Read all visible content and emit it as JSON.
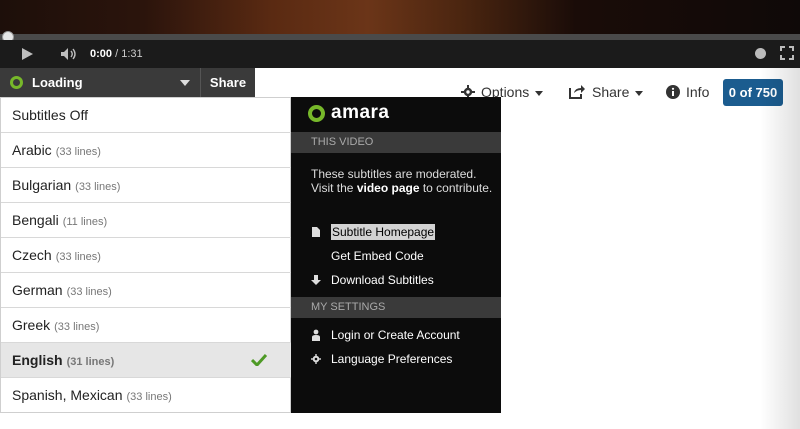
{
  "player": {
    "time_current": "0:00",
    "time_separator": " / ",
    "time_total": "1:31",
    "progress": 0.0
  },
  "subtitle_bar": {
    "status": "Loading",
    "share_label": "Share"
  },
  "toolbar": {
    "options_label": "Options",
    "share_label": "Share",
    "info_label": "Info",
    "counter": "0 of 750"
  },
  "languages": [
    {
      "name": "Subtitles Off",
      "count": "",
      "selected": false
    },
    {
      "name": "Arabic",
      "count": "(33 lines)",
      "selected": false
    },
    {
      "name": "Bulgarian",
      "count": "(33 lines)",
      "selected": false
    },
    {
      "name": "Bengali",
      "count": "(11 lines)",
      "selected": false
    },
    {
      "name": "Czech",
      "count": "(33 lines)",
      "selected": false
    },
    {
      "name": "German",
      "count": "(33 lines)",
      "selected": false
    },
    {
      "name": "Greek",
      "count": "(33 lines)",
      "selected": false
    },
    {
      "name": "English",
      "count": "(31 lines)",
      "selected": true
    },
    {
      "name": "Spanish, Mexican",
      "count": "(33 lines)",
      "selected": false
    }
  ],
  "amara_panel": {
    "logo_text": "amara",
    "section_this_video": "THIS VIDEO",
    "desc_part1": "These subtitles are moderated. Visit the ",
    "desc_link": "video page",
    "desc_part2": " to contribute.",
    "subtitle_homepage": "Subtitle Homepage",
    "get_embed_code": "Get Embed Code",
    "download_subtitles": "Download Subtitles",
    "section_my_settings": "MY SETTINGS",
    "login": "Login or Create Account",
    "language_preferences": "Language Preferences"
  },
  "colors": {
    "accent_green": "#77b82a",
    "counter_blue": "#1b5c8f",
    "panel_black": "#0c0c0c"
  },
  "icons": {
    "play": "play-icon",
    "volume": "volume-icon",
    "clock": "clock-icon",
    "fullscreen": "fullscreen-icon",
    "options": "gear-icon",
    "share": "share-icon",
    "info": "info-icon",
    "check": "check-icon",
    "homepage": "document-icon",
    "download": "download-arrow-icon",
    "login": "user-icon",
    "prefs": "gear-icon"
  }
}
